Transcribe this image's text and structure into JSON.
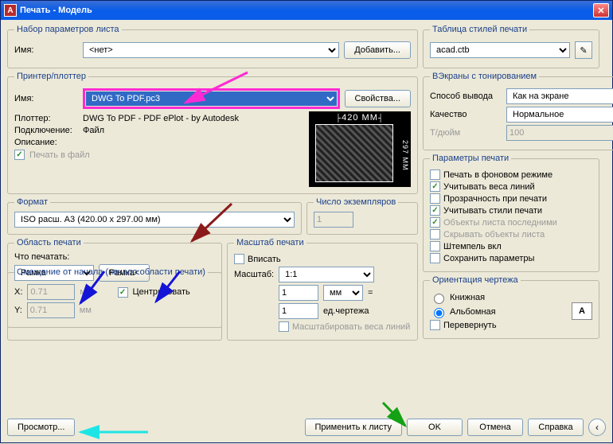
{
  "title": "Печать - Модель",
  "appicon_letter": "A",
  "pageset": {
    "legend": "Набор параметров листа",
    "name_label": "Имя:",
    "name_value": "<нет>",
    "add_btn": "Добавить..."
  },
  "printer": {
    "legend": "Принтер/плоттер",
    "name_label": "Имя:",
    "name_value": "DWG To PDF.pc3",
    "props_btn": "Свойства...",
    "plotter_label": "Плоттер:",
    "plotter_value": "DWG To PDF - PDF ePlot - by Autodesk",
    "conn_label": "Подключение:",
    "conn_value": "Файл",
    "desc_label": "Описание:",
    "print_to_file": "Печать в файл",
    "dim_top": "420 MM",
    "dim_right": "297 MM"
  },
  "format": {
    "legend": "Формат",
    "value": "ISO расш. A3 (420.00 x 297.00 мм)"
  },
  "copies": {
    "legend": "Число экземпляров",
    "value": "1"
  },
  "area": {
    "legend": "Область печати",
    "what_label": "Что печатать:",
    "what_value": "Рамка",
    "frame_btn": "Рамка<"
  },
  "scale": {
    "legend": "Масштаб печати",
    "fit_label": "Вписать",
    "scale_label": "Масштаб:",
    "scale_value": "1:1",
    "num_value": "1",
    "unit_value": "мм",
    "drawing_value": "1",
    "drawing_unit": "ед.чертежа",
    "scale_lineweights": "Масштабировать веса линий"
  },
  "offset": {
    "legend": "Смещение от начала (начало области печати)",
    "x_label": "X:",
    "x_value": "0.71",
    "y_label": "Y:",
    "y_value": "0.71",
    "unit": "мм",
    "center_label": "Центрировать"
  },
  "styletable": {
    "legend": "Таблица стилей печати",
    "value": "acad.ctb"
  },
  "vports": {
    "legend": "ВЭкраны с тонированием",
    "out_label": "Способ вывода",
    "out_value": "Как на экране",
    "qual_label": "Качество",
    "qual_value": "Нормальное",
    "dpi_label": "Т/дюйм",
    "dpi_value": "100"
  },
  "params": {
    "legend": "Параметры печати",
    "bg": "Печать в фоновом режиме",
    "lw": "Учитывать веса линий",
    "trans": "Прозрачность при печати",
    "styles": "Учитывать стили печати",
    "last": "Объекты листа последними",
    "hide": "Скрывать объекты листа",
    "stamp": "Штемпель вкл",
    "save": "Сохранить параметры"
  },
  "orient": {
    "legend": "Ориентация чертежа",
    "portrait": "Книжная",
    "landscape": "Альбомная",
    "upside": "Перевернуть",
    "letter": "A"
  },
  "footer": {
    "preview": "Просмотр...",
    "apply": "Применить к листу",
    "ok": "OK",
    "cancel": "Отмена",
    "help": "Справка"
  }
}
